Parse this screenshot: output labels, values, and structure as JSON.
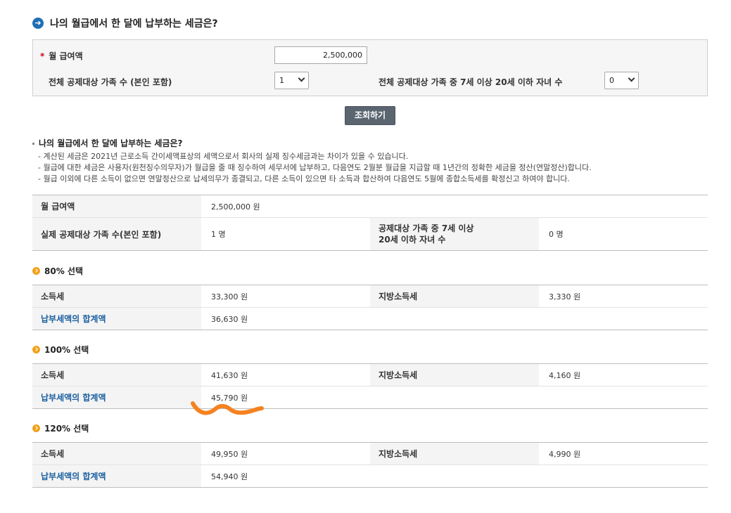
{
  "page": {
    "title": "나의 월급에서 한 달에 납부하는 세금은?"
  },
  "form": {
    "salary_label": "월 급여액",
    "salary_value": "2,500,000",
    "family_label": "전체 공제대상 가족 수 (본인 포함)",
    "family_value": "1",
    "children_label": "전체 공제대상 가족 중 7세 이상 20세 이하 자녀 수",
    "children_value": "0",
    "search_button": "조회하기"
  },
  "result": {
    "title": "나의 월급에서 한 달에 납부하는 세금은?",
    "notes": [
      "- 계산된 세금은   2021년   근로소득 간이세액표상의 세액으로서 회사의 실제 징수세금과는 차이가 있을 수 있습니다.",
      "- 월급에 대한 세금은 사용자(원천징수의무자)가 월급을 줄 때 징수하여 세무서에 납부하고, 다음연도 2월분 월급을 지급할 때 1년간의 정확한 세금을 정산(연말정산)합니다.",
      "- 월급 이외에 다른 소득이 없으면 연말정산으로 납세의무가 종결되고, 다른 소득이 있으면 타 소득과 합산하여 다음연도 5월에 종합소득세를 확정신고 하여야 합니다."
    ],
    "summary": {
      "salary_label": "월 급여액",
      "salary_value": "2,500,000  원",
      "family_label": "실제 공제대상 가족 수(본인 포함)",
      "family_value": "1  명",
      "children_label_1": "공제대상 가족 중 7세 이상",
      "children_label_2": "20세 이하 자녀 수",
      "children_value": "0  명"
    }
  },
  "sections": [
    {
      "title": "80% 선택",
      "income_tax_label": "소득세",
      "income_tax": "33,300  원",
      "local_tax_label": "지방소득세",
      "local_tax": "3,330  원",
      "total_label": "납부세액의 합계액",
      "total": "36,630  원"
    },
    {
      "title": "100% 선택",
      "income_tax_label": "소득세",
      "income_tax": "41,630  원",
      "local_tax_label": "지방소득세",
      "local_tax": "4,160  원",
      "total_label": "납부세액의 합계액",
      "total": "45,790  원"
    },
    {
      "title": "120% 선택",
      "income_tax_label": "소득세",
      "income_tax": "49,950  원",
      "local_tax_label": "지방소득세",
      "local_tax": "4,990  원",
      "total_label": "납부세액의 합계액",
      "total": "54,940  원"
    }
  ],
  "colors": {
    "accent_blue": "#1f6fb5",
    "link_blue": "#1a5fa0",
    "bullet_orange": "#f0a21b",
    "annotation_orange": "#f58220",
    "button_gray": "#5b6570"
  },
  "icons": {
    "title": "arrow-circle-icon",
    "section": "orange-bullet-icon"
  }
}
